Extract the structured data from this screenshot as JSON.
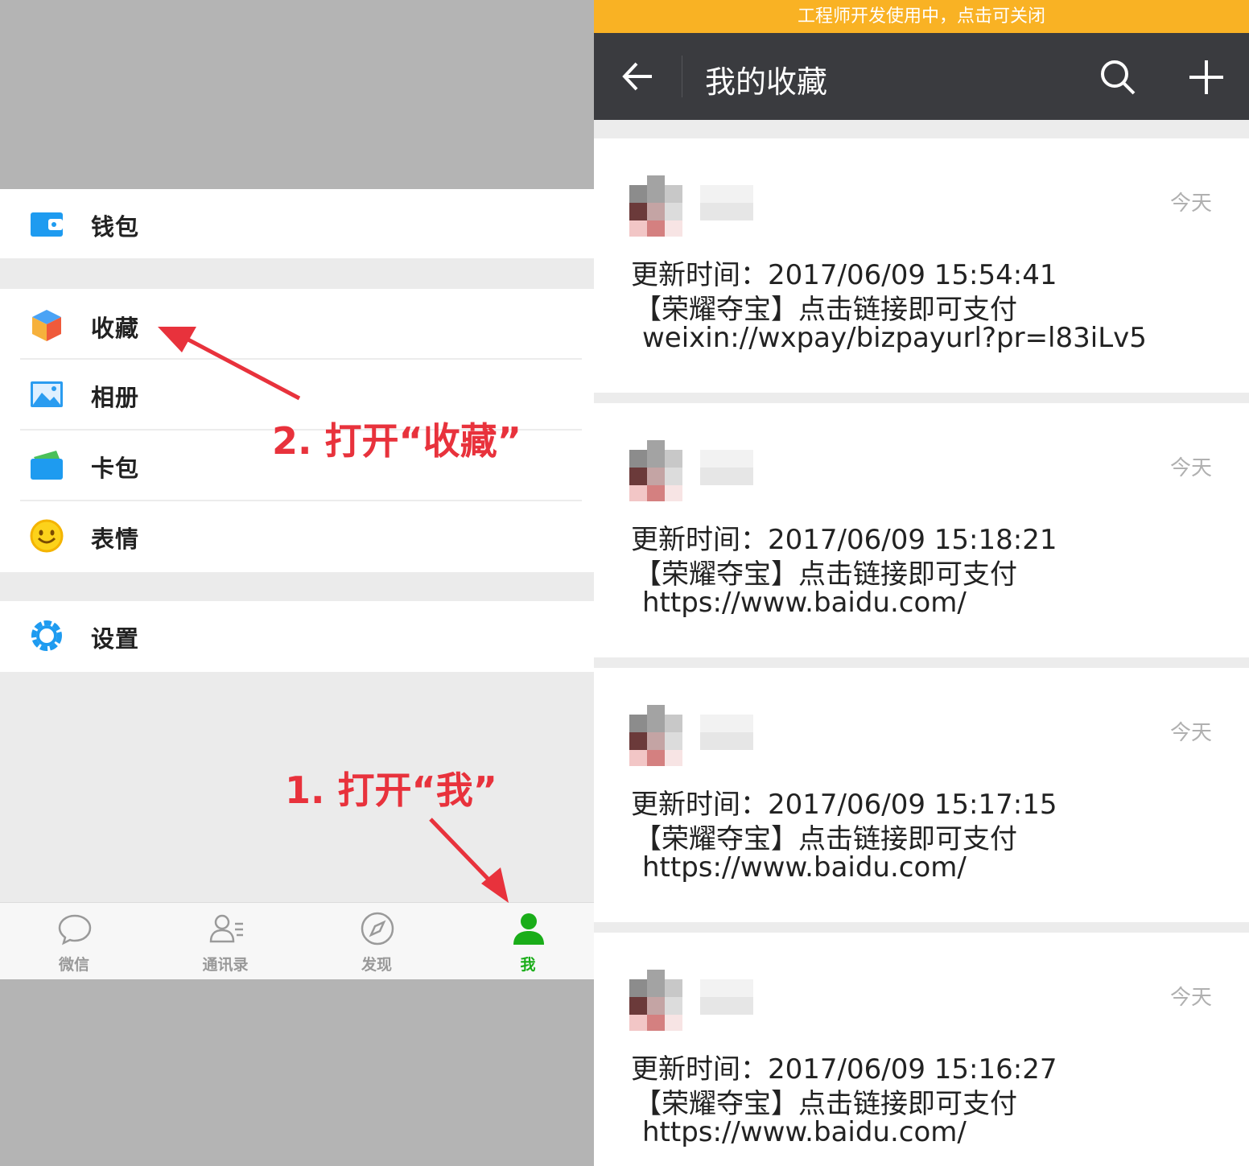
{
  "left_panel": {
    "menu": [
      {
        "id": "wallet",
        "label": "钱包"
      },
      {
        "id": "favorites",
        "label": "收藏"
      },
      {
        "id": "album",
        "label": "相册"
      },
      {
        "id": "cards",
        "label": "卡包"
      },
      {
        "id": "stickers",
        "label": "表情"
      },
      {
        "id": "settings",
        "label": "设置"
      }
    ],
    "tabs": [
      {
        "label": "微信",
        "icon": "chat-icon"
      },
      {
        "label": "通讯录",
        "icon": "contacts-icon"
      },
      {
        "label": "发现",
        "icon": "compass-icon"
      },
      {
        "label": "我",
        "icon": "person-icon",
        "active": true
      }
    ],
    "annotations": {
      "step1": "1. 打开“我”",
      "step2": "2. 打开“收藏”"
    }
  },
  "right_panel": {
    "dev_banner": "工程师开发使用中，点击可关闭",
    "title": "我的收藏",
    "items": [
      {
        "date": "今天",
        "update_time": "更新时间：2017/06/09 15:54:41",
        "text": "【荣耀夺宝】点击链接即可支付",
        "link": "weixin://wxpay/bizpayurl?pr=l83iLv5"
      },
      {
        "date": "今天",
        "update_time": "更新时间：2017/06/09 15:18:21",
        "text": "【荣耀夺宝】点击链接即可支付",
        "link": "https://www.baidu.com/"
      },
      {
        "date": "今天",
        "update_time": "更新时间：2017/06/09 15:17:15",
        "text": "【荣耀夺宝】点击链接即可支付",
        "link": "https://www.baidu.com/"
      },
      {
        "date": "今天",
        "update_time": "更新时间：2017/06/09 15:16:27",
        "text": "【荣耀夺宝】点击链接即可支付",
        "link": "https://www.baidu.com/"
      }
    ]
  },
  "colors": {
    "accent_green": "#1aad19",
    "annotation_red": "#e8323c",
    "dev_banner": "#f9b224",
    "topbar": "#3a3b3f"
  }
}
